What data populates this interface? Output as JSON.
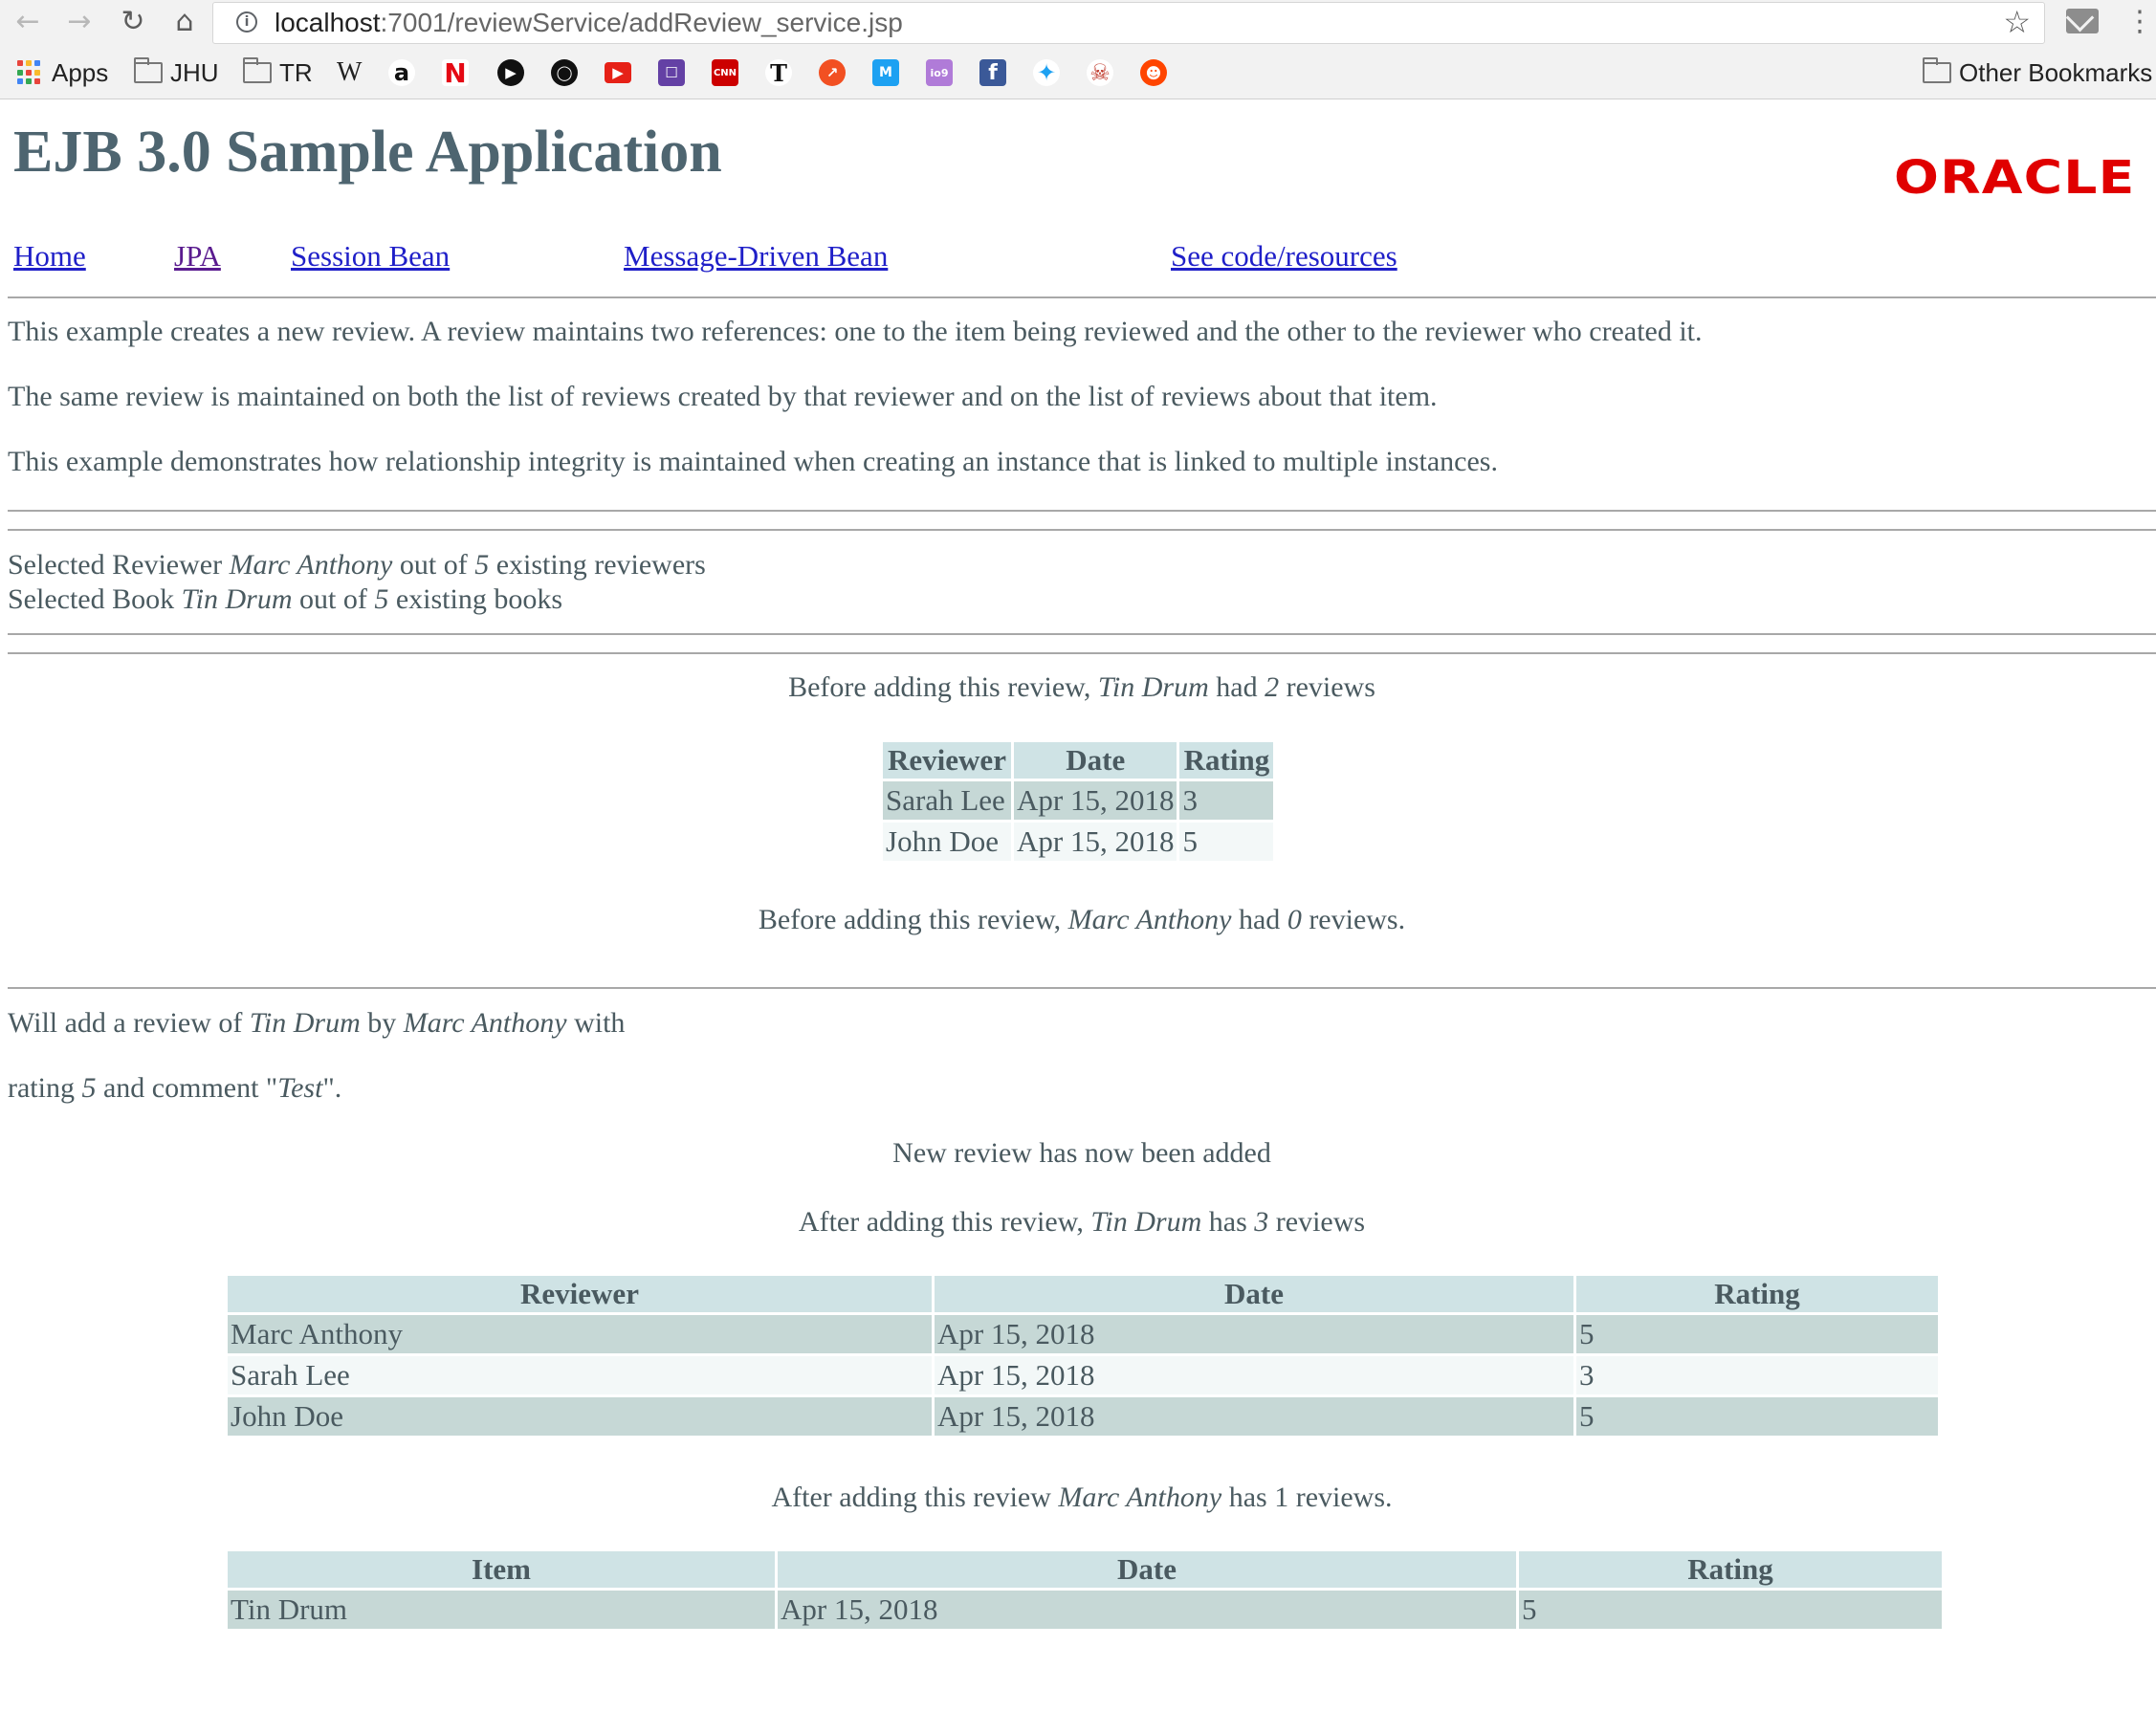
{
  "browser": {
    "url_host": "localhost",
    "url_path": ":7001/reviewService/addReview_service.jsp",
    "bookmarks": {
      "apps": "Apps",
      "jhu": "JHU",
      "tr": "TR",
      "wiki": "W",
      "other": "Other Bookmarks"
    },
    "icons": [
      "back-icon",
      "forward-icon",
      "reload-icon",
      "home-icon",
      "info-icon",
      "star-icon",
      "mail-icon",
      "menu-icon"
    ]
  },
  "header": {
    "title": "EJB 3.0 Sample Application",
    "logo": "ORACLE"
  },
  "nav": {
    "home": "Home",
    "jpa": "JPA",
    "session_bean": "Session Bean",
    "mdb": "Message-Driven Bean",
    "code": "See code/resources"
  },
  "intro": {
    "p1": "This example creates a new review. A review maintains two references: one to the item being reviewed and the other to the reviewer who created it.",
    "p2": "The same review is maintained on both the list of reviews created by that reviewer and on the list of reviews about that item.",
    "p3": "This example demonstrates how relationship integrity is maintained when creating an instance that is linked to multiple instances."
  },
  "selection": {
    "reviewer_prefix": "Selected Reviewer ",
    "reviewer": "Marc Anthony",
    "out_of": " out of ",
    "reviewer_count": "5",
    "reviewer_suffix": " existing reviewers",
    "book_prefix": "Selected Book ",
    "book": "Tin Drum",
    "book_count": "5",
    "book_suffix": " existing books"
  },
  "before": {
    "item_prefix": "Before adding this review, ",
    "item": "Tin Drum",
    "item_mid": " had ",
    "item_count": "2",
    "item_suffix": " reviews",
    "table": {
      "headers": [
        "Reviewer",
        "Date",
        "Rating"
      ],
      "rows": [
        [
          "Sarah Lee",
          "Apr 15, 2018",
          "3"
        ],
        [
          "John Doe",
          "Apr 15, 2018",
          "5"
        ]
      ]
    },
    "reviewer_prefix": "Before adding this review, ",
    "reviewer": "Marc Anthony",
    "reviewer_mid": " had ",
    "reviewer_count": "0",
    "reviewer_suffix": " reviews."
  },
  "add": {
    "line1_prefix": "Will add a review of ",
    "item": "Tin Drum",
    "by": " by ",
    "reviewer": "Marc Anthony",
    "with": " with",
    "rating_prefix": "rating ",
    "rating": "5",
    "comment_prefix": " and comment \"",
    "comment": "Test",
    "comment_suffix": "\".",
    "added": "New review has now been added"
  },
  "after": {
    "item_prefix": "After adding this review, ",
    "item": "Tin Drum",
    "item_mid": " has ",
    "item_count": "3",
    "item_suffix": " reviews",
    "table": {
      "headers": [
        "Reviewer",
        "Date",
        "Rating"
      ],
      "rows": [
        [
          "Marc Anthony",
          "Apr 15, 2018",
          "5"
        ],
        [
          "Sarah Lee",
          "Apr 15, 2018",
          "3"
        ],
        [
          "John Doe",
          "Apr 15, 2018",
          "5"
        ]
      ]
    },
    "reviewer_prefix": "After adding this review ",
    "reviewer": "Marc Anthony",
    "reviewer_suffix": " has 1 reviews.",
    "reviewer_table": {
      "headers": [
        "Item",
        "Date",
        "Rating"
      ],
      "rows": [
        [
          "Tin Drum",
          "Apr 15, 2018",
          "5"
        ]
      ]
    }
  }
}
